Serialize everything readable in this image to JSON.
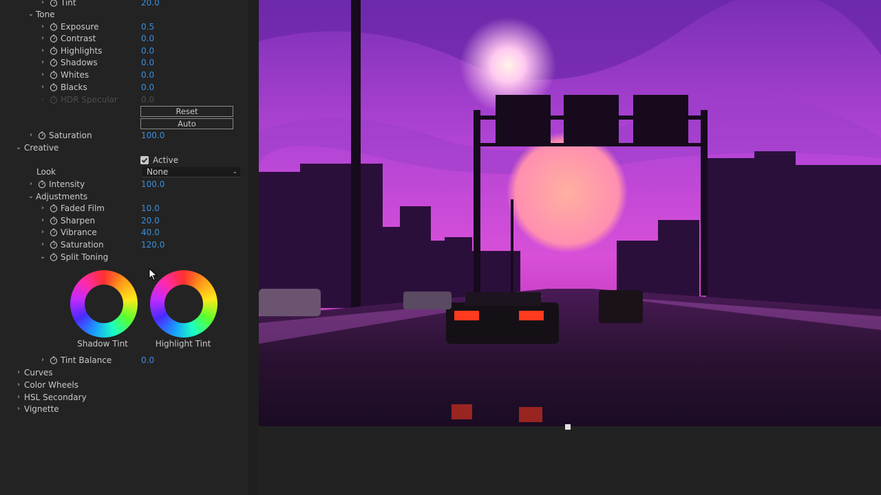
{
  "tone": {
    "tint_label": "Tint",
    "tint_value": "20.0",
    "header": "Tone",
    "exposure_label": "Exposure",
    "exposure_value": "0.5",
    "contrast_label": "Contrast",
    "contrast_value": "0.0",
    "highlights_label": "Highlights",
    "highlights_value": "0.0",
    "shadows_label": "Shadows",
    "shadows_value": "0.0",
    "whites_label": "Whites",
    "whites_value": "0.0",
    "blacks_label": "Blacks",
    "blacks_value": "0.0",
    "hdr_label": "HDR Specular",
    "hdr_value": "0.0",
    "reset_label": "Reset",
    "auto_label": "Auto",
    "saturation_label": "Saturation",
    "saturation_value": "100.0"
  },
  "creative": {
    "header": "Creative",
    "active_label": "Active",
    "look_label": "Look",
    "look_value": "None",
    "intensity_label": "Intensity",
    "intensity_value": "100.0",
    "adjustments_label": "Adjustments",
    "faded_film_label": "Faded Film",
    "faded_film_value": "10.0",
    "sharpen_label": "Sharpen",
    "sharpen_value": "20.0",
    "vibrance_label": "Vibrance",
    "vibrance_value": "40.0",
    "saturation_label": "Saturation",
    "saturation_value": "120.0",
    "split_toning_label": "Split Toning",
    "shadow_tint_label": "Shadow Tint",
    "highlight_tint_label": "Highlight Tint",
    "tint_balance_label": "Tint Balance",
    "tint_balance_value": "0.0"
  },
  "sections": {
    "curves": "Curves",
    "color_wheels": "Color Wheels",
    "hsl_secondary": "HSL Secondary",
    "vignette": "Vignette"
  },
  "colors": {
    "value_blue": "#3a8fdd",
    "panel_bg": "#232323"
  },
  "icons": {
    "twirl": "chevron-icon",
    "stopwatch": "stopwatch-icon",
    "checkbox": "checkmark-icon"
  }
}
